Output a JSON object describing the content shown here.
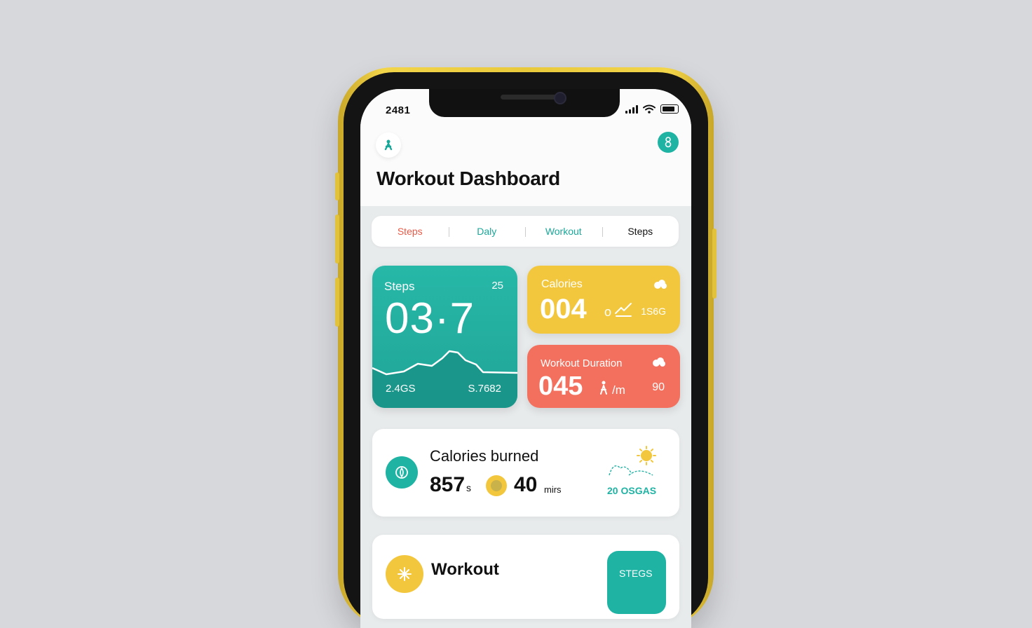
{
  "status_bar": {
    "time": "2481"
  },
  "header": {
    "title": "Workout Dashboard"
  },
  "tabs": [
    {
      "label": "Steps",
      "color": "#e85a47"
    },
    {
      "label": "Daly",
      "color": "#1aa89a"
    },
    {
      "label": "Workout",
      "color": "#1aa89a"
    },
    {
      "label": "Steps",
      "color": "#111111"
    }
  ],
  "steps_card": {
    "title": "Steps",
    "corner": "25",
    "value": "03·7",
    "left_stat": "2.4GS",
    "right_stat": "S.7682",
    "color": "#22ad9f"
  },
  "calories_card": {
    "title": "Calories",
    "value": "004",
    "unit": "o",
    "side": "1S6G",
    "color": "#f3c73d"
  },
  "duration_card": {
    "title": "Workout Duration",
    "value": "045",
    "unit": "/m",
    "side": "90",
    "color": "#f4705e"
  },
  "calories_burned": {
    "title": "Calories burned",
    "value": "857",
    "value_suffix": "s",
    "minutes": "40",
    "minutes_unit": "mirs",
    "side_label": "20 OSGAS"
  },
  "workout_row": {
    "title": "Workout",
    "badge": "STEGS"
  },
  "accent_colors": {
    "teal": "#1fb3a4",
    "yellow": "#f3c73d",
    "coral": "#f4705e"
  }
}
